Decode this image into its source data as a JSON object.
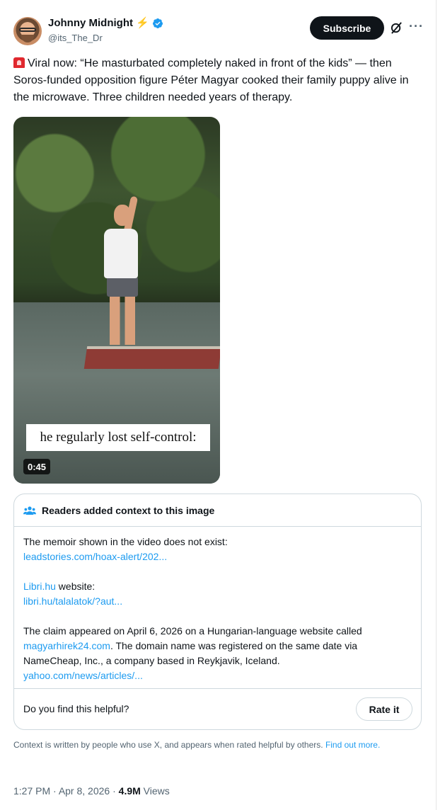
{
  "author": {
    "display_name": "Johnny Midnight",
    "bolt_emoji": "⚡",
    "handle": "@its_The_Dr"
  },
  "actions": {
    "subscribe_label": "Subscribe",
    "more_label": "···"
  },
  "tweet": {
    "text": "Viral now: “He masturbated completely naked in front of the kids” — then Soros-funded opposition figure Péter Magyar cooked their family puppy alive in the microwave. Three children needed years of therapy."
  },
  "media": {
    "caption": "he regularly lost self-control:",
    "duration": "0:45"
  },
  "community_note": {
    "title": "Readers added context to this image",
    "line1": "The memoir shown in the video does not exist:",
    "link1": "leadstories.com/hoax-alert/202...",
    "site_link": "Libri.hu",
    "site_suffix": " website:",
    "link2": "libri.hu/talalatok/?aut...",
    "claim_part1": "The claim appeared on April 6, 2026 on a Hungarian-language website called ",
    "claim_link": "magyarhirek24.com",
    "claim_part2": ". The domain name was registered on the same date via NameCheap, Inc., a company based in Reykjavik, Iceland.",
    "link3": "yahoo.com/news/articles/...",
    "helpful_question": "Do you find this helpful?",
    "rate_label": "Rate it"
  },
  "disclaimer": {
    "text": "Context is written by people who use X, and appears when rated helpful by others. ",
    "link": "Find out more."
  },
  "meta": {
    "time": "1:27 PM",
    "separator": " · ",
    "date": "Apr 8, 2026",
    "views_count": "4.9M",
    "views_label": " Views"
  },
  "colors": {
    "link": "#1d9bf0",
    "verified": "#1d9bf0",
    "text": "#0f1419",
    "muted": "#536471"
  }
}
